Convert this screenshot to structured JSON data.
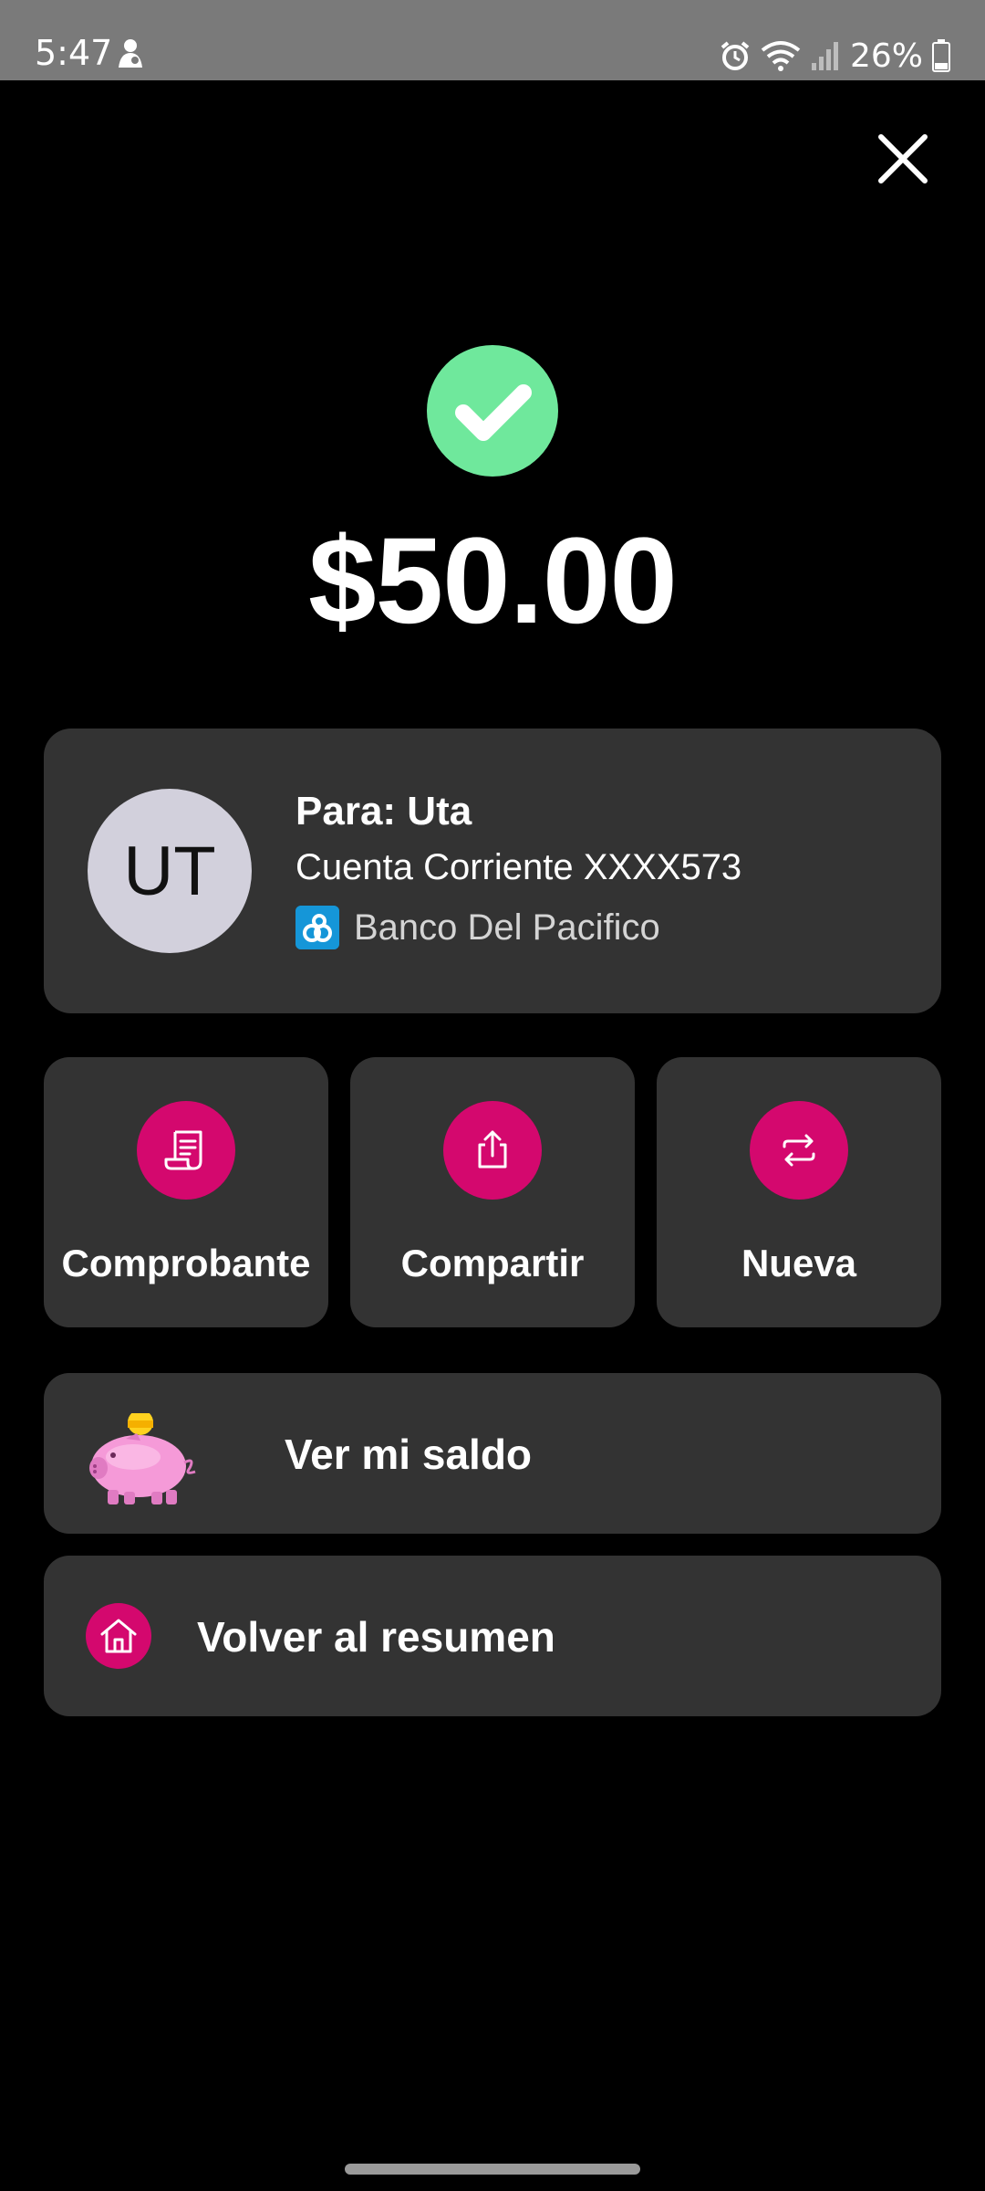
{
  "status_bar": {
    "time": "5:47",
    "battery": "26%",
    "icons": [
      "app-notification-icon",
      "alarm-icon",
      "wifi-icon",
      "signal-icon",
      "battery-icon"
    ]
  },
  "header": {
    "close_icon": "close-icon"
  },
  "transfer": {
    "status_icon": "check-circle-icon",
    "amount": "$50.00"
  },
  "recipient": {
    "avatar_initials": "UT",
    "name": "Para: Uta",
    "account": "Cuenta Corriente XXXX573",
    "bank": "Banco Del Pacifico"
  },
  "actions": [
    {
      "label": "Comprobante",
      "icon": "receipt-icon"
    },
    {
      "label": "Compartir",
      "icon": "share-icon"
    },
    {
      "label": "Nueva",
      "icon": "repeat-icon"
    }
  ],
  "links": {
    "balance_label": "Ver mi saldo",
    "balance_icon": "piggy-bank-icon",
    "home_label": "Volver al resumen",
    "home_icon": "home-icon"
  },
  "colors": {
    "background": "#000000",
    "card": "#333333",
    "accent": "#d4086e",
    "success": "#6fe89c",
    "avatar": "#d2d0dc",
    "bank_brand": "#1596d8"
  }
}
